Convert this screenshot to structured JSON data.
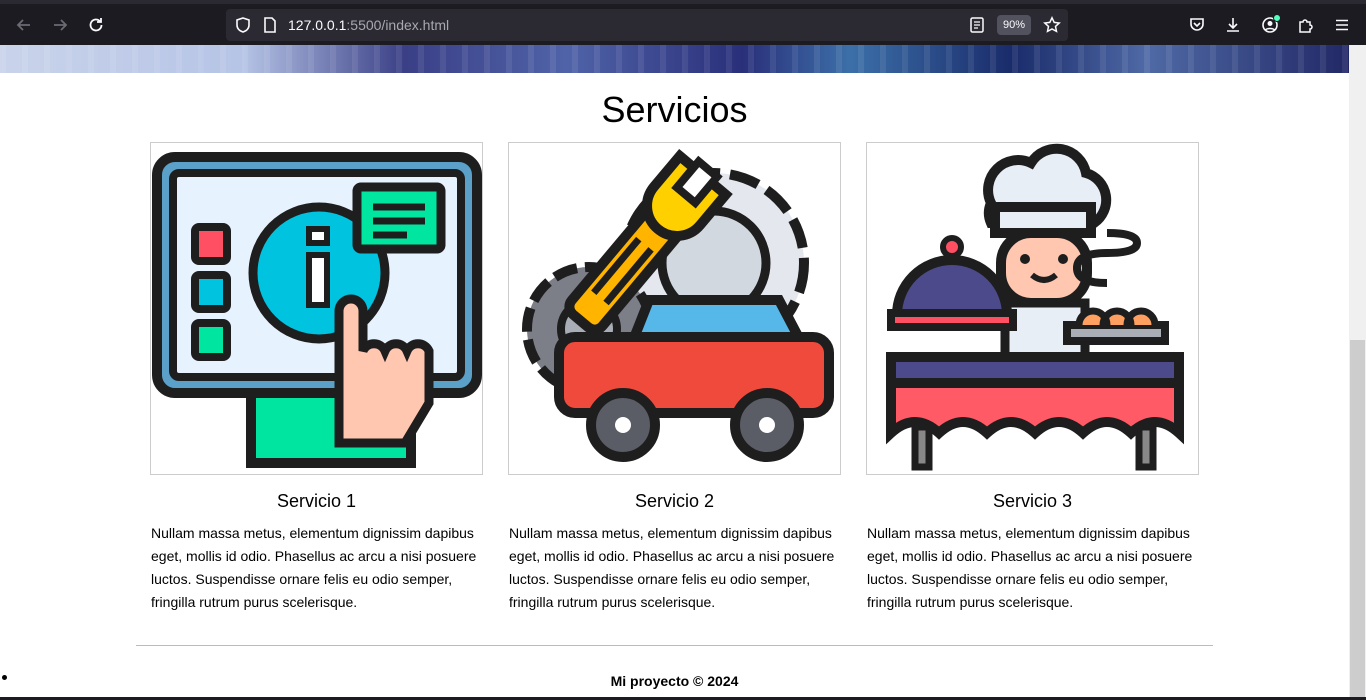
{
  "browser": {
    "url_host": "127.0.0.1",
    "url_rest": ":5500/index.html",
    "zoom": "90%"
  },
  "page": {
    "section_title": "Servicios",
    "services": [
      {
        "title": "Servicio 1",
        "image_icon": "info-kiosk-icon",
        "text": "Nullam massa metus, elementum dignissim dapibus eget, mollis id odio. Phasellus ac arcu a nisi posuere luctos. Suspendisse ornare felis eu odio semper, fringilla rutrum purus scelerisque."
      },
      {
        "title": "Servicio 2",
        "image_icon": "car-repair-icon",
        "text": "Nullam massa metus, elementum dignissim dapibus eget, mollis id odio. Phasellus ac arcu a nisi posuere luctos. Suspendisse ornare felis eu odio semper, fringilla rutrum purus scelerisque."
      },
      {
        "title": "Servicio 3",
        "image_icon": "chef-catering-icon",
        "text": "Nullam massa metus, elementum dignissim dapibus eget, mollis id odio. Phasellus ac arcu a nisi posuere luctos. Suspendisse ornare felis eu odio semper, fringilla rutrum purus scelerisque."
      }
    ],
    "footer": "Mi proyecto © 2024"
  }
}
